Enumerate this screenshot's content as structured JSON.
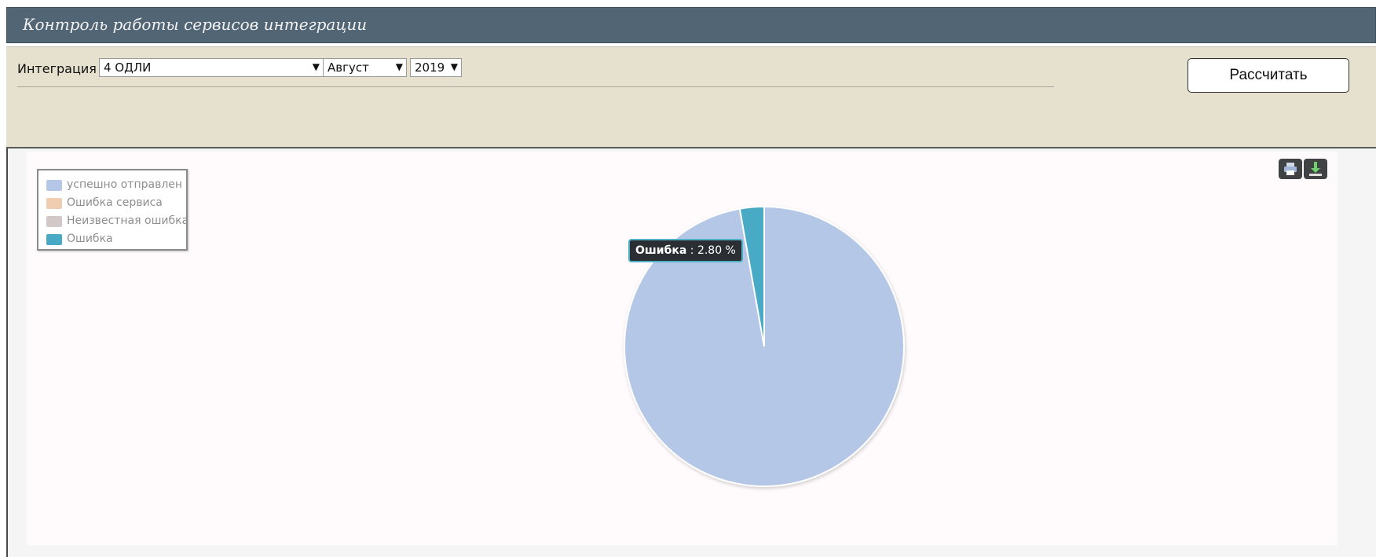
{
  "header": {
    "title": "Контроль работы сервисов интеграции"
  },
  "filters": {
    "integration_label": "Интеграция",
    "integration_value": "4 ОДЛИ",
    "month_value": "Август",
    "year_value": "2019",
    "dropdown_arrow": "▼"
  },
  "actions": {
    "calculate_label": "Рассчитать"
  },
  "chart_tools": {
    "print_icon": "print-icon",
    "download_icon": "download-icon"
  },
  "chart_data": {
    "type": "pie",
    "title": "",
    "slices": [
      {
        "label": "успешно отправлен",
        "value": 97.2,
        "color": "#b4c7e7"
      },
      {
        "label": "Ошибка сервиса",
        "value": 0,
        "color": "#f0cdb0"
      },
      {
        "label": "Неизвестная ошибка",
        "value": 0,
        "color": "#d2c8c8"
      },
      {
        "label": "Ошибка",
        "value": 2.8,
        "color": "#4aaac6"
      }
    ],
    "legend_position": "top-left",
    "tooltip": {
      "series": "Ошибка",
      "separator": ":",
      "value_text": "2.80 %"
    }
  }
}
